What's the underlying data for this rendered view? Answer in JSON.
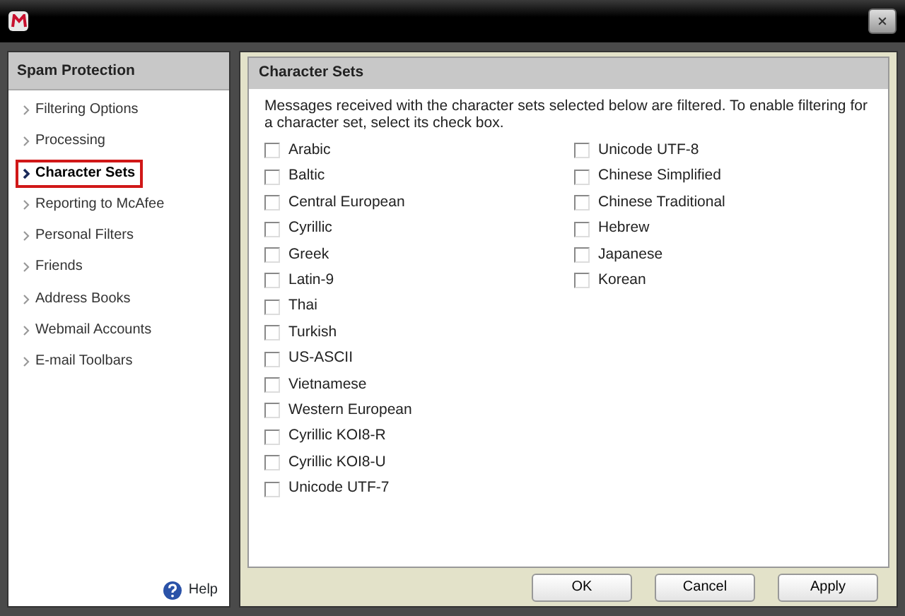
{
  "sidebar": {
    "title": "Spam Protection",
    "items": [
      {
        "label": "Filtering Options",
        "selected": false
      },
      {
        "label": "Processing",
        "selected": false
      },
      {
        "label": "Character Sets",
        "selected": true
      },
      {
        "label": "Reporting to McAfee",
        "selected": false
      },
      {
        "label": "Personal Filters",
        "selected": false
      },
      {
        "label": "Friends",
        "selected": false
      },
      {
        "label": "Address Books",
        "selected": false
      },
      {
        "label": "Webmail Accounts",
        "selected": false
      },
      {
        "label": "E-mail Toolbars",
        "selected": false
      }
    ],
    "help": "Help"
  },
  "panel": {
    "title": "Character Sets",
    "description": "Messages received with the character sets selected below are filtered. To enable filtering for a character set, select its check box.",
    "columns": [
      [
        {
          "label": "Arabic",
          "checked": false
        },
        {
          "label": "Baltic",
          "checked": false
        },
        {
          "label": "Central European",
          "checked": false
        },
        {
          "label": "Cyrillic",
          "checked": false
        },
        {
          "label": "Greek",
          "checked": false
        },
        {
          "label": "Latin-9",
          "checked": false
        },
        {
          "label": "Thai",
          "checked": false
        },
        {
          "label": "Turkish",
          "checked": false
        },
        {
          "label": "US-ASCII",
          "checked": false
        },
        {
          "label": "Vietnamese",
          "checked": false
        },
        {
          "label": "Western European",
          "checked": false
        },
        {
          "label": "Cyrillic KOI8-R",
          "checked": false
        },
        {
          "label": "Cyrillic KOI8-U",
          "checked": false
        },
        {
          "label": "Unicode UTF-7",
          "checked": false
        }
      ],
      [
        {
          "label": "Unicode UTF-8",
          "checked": false
        },
        {
          "label": "Chinese Simplified",
          "checked": false
        },
        {
          "label": "Chinese Traditional",
          "checked": false
        },
        {
          "label": "Hebrew",
          "checked": false
        },
        {
          "label": "Japanese",
          "checked": false
        },
        {
          "label": "Korean",
          "checked": false
        }
      ]
    ]
  },
  "buttons": [
    "OK",
    "Cancel",
    "Apply"
  ]
}
